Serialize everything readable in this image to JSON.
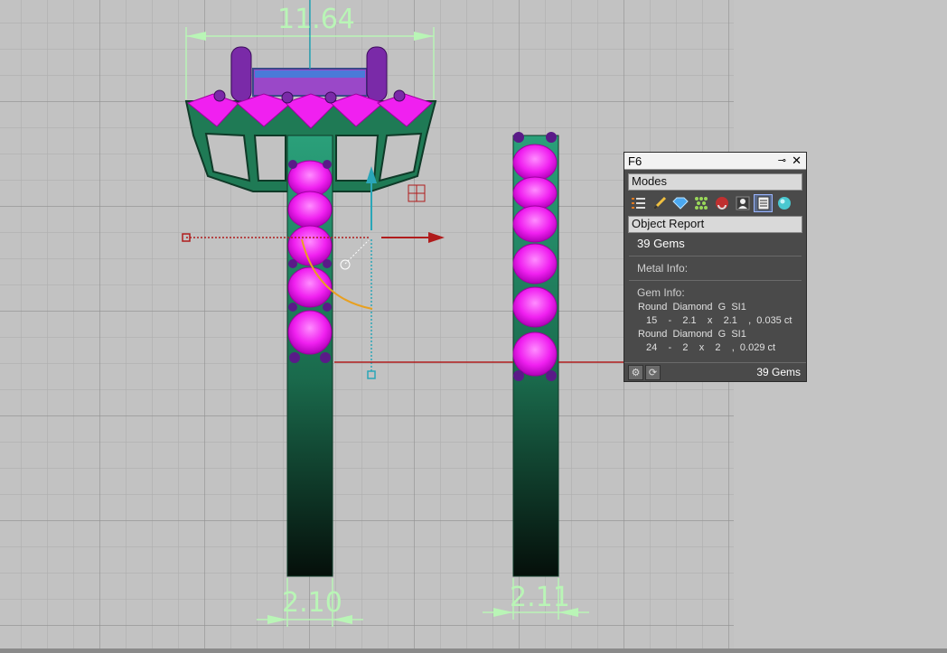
{
  "dimensions": {
    "top_width": "11.64",
    "left_shank": "2.10",
    "right_shank": "2.11"
  },
  "panel": {
    "window_title": "F6",
    "pin_icon": "pin-icon",
    "close_icon": "close-icon",
    "modes_header": "Modes",
    "modes": [
      {
        "name": "list-mode-icon"
      },
      {
        "name": "pencil-mode-icon"
      },
      {
        "name": "gem-mode-icon"
      },
      {
        "name": "pave-mode-icon"
      },
      {
        "name": "magnet-mode-icon"
      },
      {
        "name": "user-mode-icon"
      },
      {
        "name": "report-mode-icon",
        "active": true
      },
      {
        "name": "render-sphere-icon"
      }
    ],
    "report_header": "Object Report",
    "gem_count": "39 Gems",
    "metal_info_label": "Metal Info:",
    "gem_info_label": "Gem Info:",
    "gems": [
      {
        "desc": "Round  Diamond  G  SI1",
        "dims": "15    -    2.1    x    2.1    ,  0.035 ct"
      },
      {
        "desc": "Round  Diamond  G  SI1",
        "dims": "24    -    2    x    2    ,  0.029 ct"
      }
    ],
    "footer_total": "39 Gems"
  },
  "colors": {
    "viewport_bg": "#c2c2c2",
    "grid": "#9e9e9e",
    "metal": "#1f8a5e",
    "gem": "#f020f0",
    "prong": "#7a2aa8",
    "dimension": "#b9f5b6",
    "gizmo_red": "#b01c1c",
    "gizmo_cyan": "#2aa6b8"
  }
}
